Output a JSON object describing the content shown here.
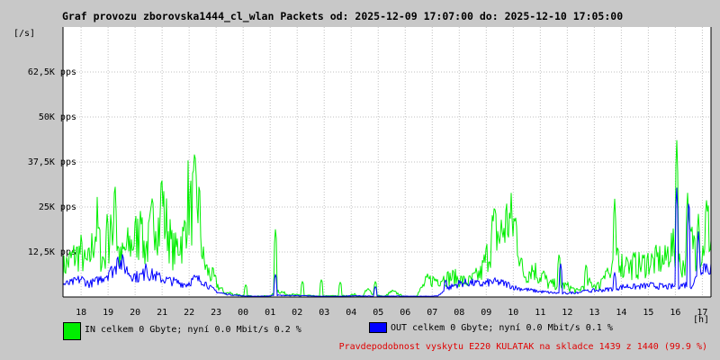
{
  "chart_data": {
    "type": "area",
    "title": "Graf provozu zborovska1444_cl_wlan Packets od: 2025-12-09 17:07:00 do: 2025-12-10 17:05:00",
    "ylabel": "[/s]",
    "xlabel": "[h]",
    "y_ticks": [
      "12,5K pps",
      "25K pps",
      "37,5K pps",
      "50K pps",
      "62,5K pps"
    ],
    "y_tick_values": [
      12500,
      25000,
      37500,
      50000,
      62500
    ],
    "ylim": [
      0,
      75000
    ],
    "x_ticks": [
      "18",
      "19",
      "20",
      "21",
      "22",
      "23",
      "00",
      "01",
      "02",
      "03",
      "04",
      "05",
      "06",
      "07",
      "08",
      "09",
      "10",
      "11",
      "12",
      "13",
      "14",
      "15",
      "16",
      "17"
    ],
    "xlim_hours": [
      -0.67,
      23.32
    ],
    "grid": true,
    "series": [
      {
        "name": "IN",
        "color": "#00ee00",
        "x_hours": [
          -0.67,
          -0.5,
          -0.3,
          0,
          0.15,
          0.3,
          0.45,
          0.6,
          0.75,
          0.9,
          1,
          1.15,
          1.25,
          1.45,
          1.6,
          1.75,
          1.9,
          2.05,
          2.2,
          2.35,
          2.5,
          2.6,
          2.75,
          2.9,
          3.05,
          3.2,
          3.35,
          3.5,
          3.65,
          3.8,
          3.95,
          4.05,
          4.2,
          4.35,
          4.5,
          4.65,
          4.8,
          4.9,
          5.05,
          5.2,
          5.35,
          5.5,
          5.65,
          5.8,
          5.95,
          6.1,
          6.4,
          6.8,
          7,
          7.3,
          7.6,
          7.9,
          8.1,
          8.25,
          8.4,
          8.8,
          9.2,
          9.6,
          9.9,
          10.1,
          10.25,
          10.4,
          10.6,
          10.9,
          11.1,
          11.25,
          11.5,
          11.75,
          11.9,
          12.1,
          12.4,
          12.8,
          13.3,
          13.8,
          14.3,
          14.8,
          15.15,
          15.25,
          15.5,
          15.8,
          16.1,
          16.35,
          16.5,
          16.65,
          16.8,
          16.95,
          17.1,
          17.3,
          17.6,
          18,
          18.4,
          18.7,
          19,
          19.2,
          19.4,
          19.6,
          19.9,
          20.1,
          20.3,
          20.45,
          20.6,
          20.8,
          21,
          21.2,
          21.4,
          21.6,
          21.8,
          22,
          22.1,
          22.25,
          22.4,
          22.55,
          22.7,
          22.85,
          23,
          23.15,
          23.32
        ],
        "values": [
          8000,
          9500,
          11000,
          12500,
          9000,
          10000,
          15500,
          20000,
          10500,
          11000,
          8500,
          21000,
          18500,
          10000,
          12500,
          14000,
          15000,
          17000,
          16500,
          13500,
          15000,
          19000,
          24000,
          18500,
          22000,
          19500,
          13500,
          12500,
          16000,
          15500,
          28000,
          23500,
          27500,
          26500,
          11000,
          7500,
          6000,
          5500,
          3200,
          2000,
          1000,
          1200,
          600,
          800,
          300,
          400,
          200,
          300,
          200,
          1800,
          800,
          600,
          500,
          300,
          400,
          200,
          300,
          400,
          300,
          800,
          200,
          100,
          2000,
          500,
          300,
          200,
          1500,
          900,
          200,
          100,
          200,
          4500,
          5000,
          5500,
          4000,
          6500,
          14000,
          19000,
          16500,
          21500,
          19500,
          6500,
          6000,
          8000,
          7500,
          5500,
          6200,
          3500,
          3500,
          3000,
          1500,
          4000,
          3500,
          3000,
          8500,
          5500,
          12000,
          7200,
          8000,
          9000,
          8500,
          9000,
          10000,
          9500,
          10500,
          9500,
          14000,
          12500,
          9500,
          9000,
          9000,
          16500,
          13000,
          13500,
          11000,
          22000,
          15000,
          12500,
          11000
        ],
        "spikes": [
          [
            0.97,
            24000
          ],
          [
            1.25,
            33000
          ],
          [
            2.2,
            24500
          ],
          [
            2.98,
            35500
          ],
          [
            6.1,
            3500
          ],
          [
            7.2,
            19500
          ],
          [
            8.2,
            4500
          ],
          [
            8.9,
            5000
          ],
          [
            9.6,
            4300
          ],
          [
            10.9,
            4500
          ],
          [
            13.4,
            5000
          ],
          [
            13.6,
            2500
          ],
          [
            14.5,
            2500
          ],
          [
            16.1,
            2200
          ],
          [
            17.7,
            12500
          ],
          [
            18.7,
            9500
          ],
          [
            19.75,
            28000
          ],
          [
            19.85,
            14000
          ],
          [
            20.2,
            12000
          ],
          [
            21.7,
            10500
          ],
          [
            22.05,
            44500
          ],
          [
            22.45,
            29500
          ],
          [
            22.7,
            18500
          ],
          [
            22.85,
            23500
          ]
        ]
      },
      {
        "name": "OUT",
        "color": "#0000ff",
        "x_hours": [
          -0.67,
          -0.4,
          0,
          0.3,
          0.6,
          0.9,
          1.2,
          1.5,
          1.8,
          2.1,
          2.4,
          2.7,
          3,
          3.3,
          3.6,
          3.9,
          4.2,
          4.5,
          4.8,
          5.1,
          5.4,
          5.7,
          6,
          6.4,
          6.8,
          7.2,
          7.6,
          8,
          8.4,
          8.8,
          9.2,
          9.6,
          10,
          10.4,
          10.8,
          11.2,
          11.6,
          12,
          12.4,
          12.8,
          13.2,
          13.6,
          14,
          14.4,
          14.8,
          15.2,
          15.5,
          15.8,
          16.1,
          16.4,
          16.7,
          17,
          17.4,
          17.8,
          18.2,
          18.6,
          19,
          19.4,
          19.8,
          20.2,
          20.5,
          20.8,
          21.1,
          21.4,
          21.7,
          22,
          22.2,
          22.4,
          22.6,
          22.8,
          23,
          23.32
        ],
        "values": [
          3500,
          3800,
          5000,
          3600,
          4500,
          6000,
          7500,
          9500,
          6500,
          5500,
          6500,
          6000,
          5000,
          4500,
          4000,
          3500,
          5000,
          4600,
          2500,
          1200,
          800,
          500,
          300,
          200,
          200,
          500,
          400,
          400,
          300,
          200,
          200,
          200,
          300,
          300,
          200,
          200,
          300,
          200,
          200,
          200,
          300,
          2500,
          3800,
          4000,
          3500,
          4200,
          4000,
          3500,
          2500,
          2200,
          1800,
          1500,
          1200,
          1000,
          1200,
          1500,
          1800,
          2000,
          2500,
          3000,
          2800,
          3000,
          3200,
          3000,
          2800,
          3000,
          3200,
          3500,
          3200,
          5500,
          9000,
          8000
        ],
        "spikes": [
          [
            1.35,
            12000
          ],
          [
            2.4,
            9500
          ],
          [
            1.05,
            8000
          ],
          [
            7.2,
            6500
          ],
          [
            10.9,
            3000
          ],
          [
            13.5,
            5000
          ],
          [
            17.75,
            9500
          ],
          [
            18.6,
            2000
          ],
          [
            19.75,
            7000
          ],
          [
            22.05,
            31000
          ],
          [
            22.5,
            28000
          ],
          [
            22.85,
            18500
          ]
        ]
      }
    ]
  },
  "legend": {
    "in_label": "IN celkem 0 Gbyte; nyní   0.0 Mbit/s 0.2 %",
    "out_label": "OUT celkem 0 Gbyte; nyní   0.0 Mbit/s 0.1 %",
    "in_color": "#00ee00",
    "out_color": "#0000ff"
  },
  "footnote": "Pravdepodobnost vyskytu E220 KULATAK na skladce 1439 z 1440 (99.9 %)",
  "colors": {
    "background": "#c8c8c8",
    "plot_background": "#ffffff",
    "grid": "#c0c0c0",
    "footnote": "#e00000"
  }
}
